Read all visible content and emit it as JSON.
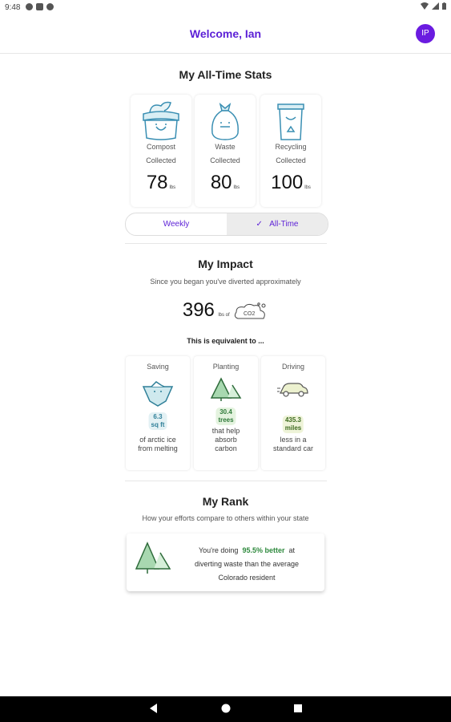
{
  "status_bar": {
    "time": "9:48"
  },
  "header": {
    "title": "Welcome, Ian",
    "avatar_initials": "IP"
  },
  "stats": {
    "title": "My All-Time Stats",
    "cards": [
      {
        "label_line1": "Compost",
        "label_line2": "Collected",
        "value": "78",
        "unit": "lbs"
      },
      {
        "label_line1": "Waste",
        "label_line2": "Collected",
        "value": "80",
        "unit": "lbs"
      },
      {
        "label_line1": "Recycling",
        "label_line2": "Collected",
        "value": "100",
        "unit": "lbs"
      }
    ],
    "toggle": {
      "weekly": "Weekly",
      "all_time": "All-Time",
      "selected": "All-Time"
    }
  },
  "impact": {
    "title": "My Impact",
    "subtitle": "Since you began you've diverted approximately",
    "co2_value": "396",
    "co2_unit": "lbs of",
    "co2_label": "CO2",
    "equivalent": "This is equivalent to ...",
    "cards": [
      {
        "heading": "Saving",
        "value_line1": "6.3",
        "value_line2": "sq ft",
        "desc_line1": "of arctic ice",
        "desc_line2": "from melting",
        "desc_line3": ""
      },
      {
        "heading": "Planting",
        "value_line1": "30.4",
        "value_line2": "trees",
        "desc_line1": "that help",
        "desc_line2": "absorb",
        "desc_line3": "carbon"
      },
      {
        "heading": "Driving",
        "value_line1": "435.3",
        "value_line2": "miles",
        "desc_line1": "less in a",
        "desc_line2": "standard car",
        "desc_line3": ""
      }
    ]
  },
  "rank": {
    "title": "My Rank",
    "subtitle": "How your efforts compare to others within your state",
    "text_before": "You're doing",
    "highlight": "95.5% better",
    "text_after": "at",
    "line2": "diverting waste than the average",
    "line3": "Colorado resident"
  },
  "colors": {
    "accent": "#5b1fd6",
    "avatar": "#6a1be0",
    "ice_pill": "#e3f1f4",
    "tree_pill": "#e4f3df",
    "car_pill": "#eef3d8",
    "green_text": "#2f8a3e"
  },
  "icons": [
    "compost-bin-icon",
    "trash-bag-icon",
    "recycling-bin-icon",
    "iceberg-icon",
    "pine-trees-icon",
    "car-icon",
    "co2-cloud-icon"
  ]
}
